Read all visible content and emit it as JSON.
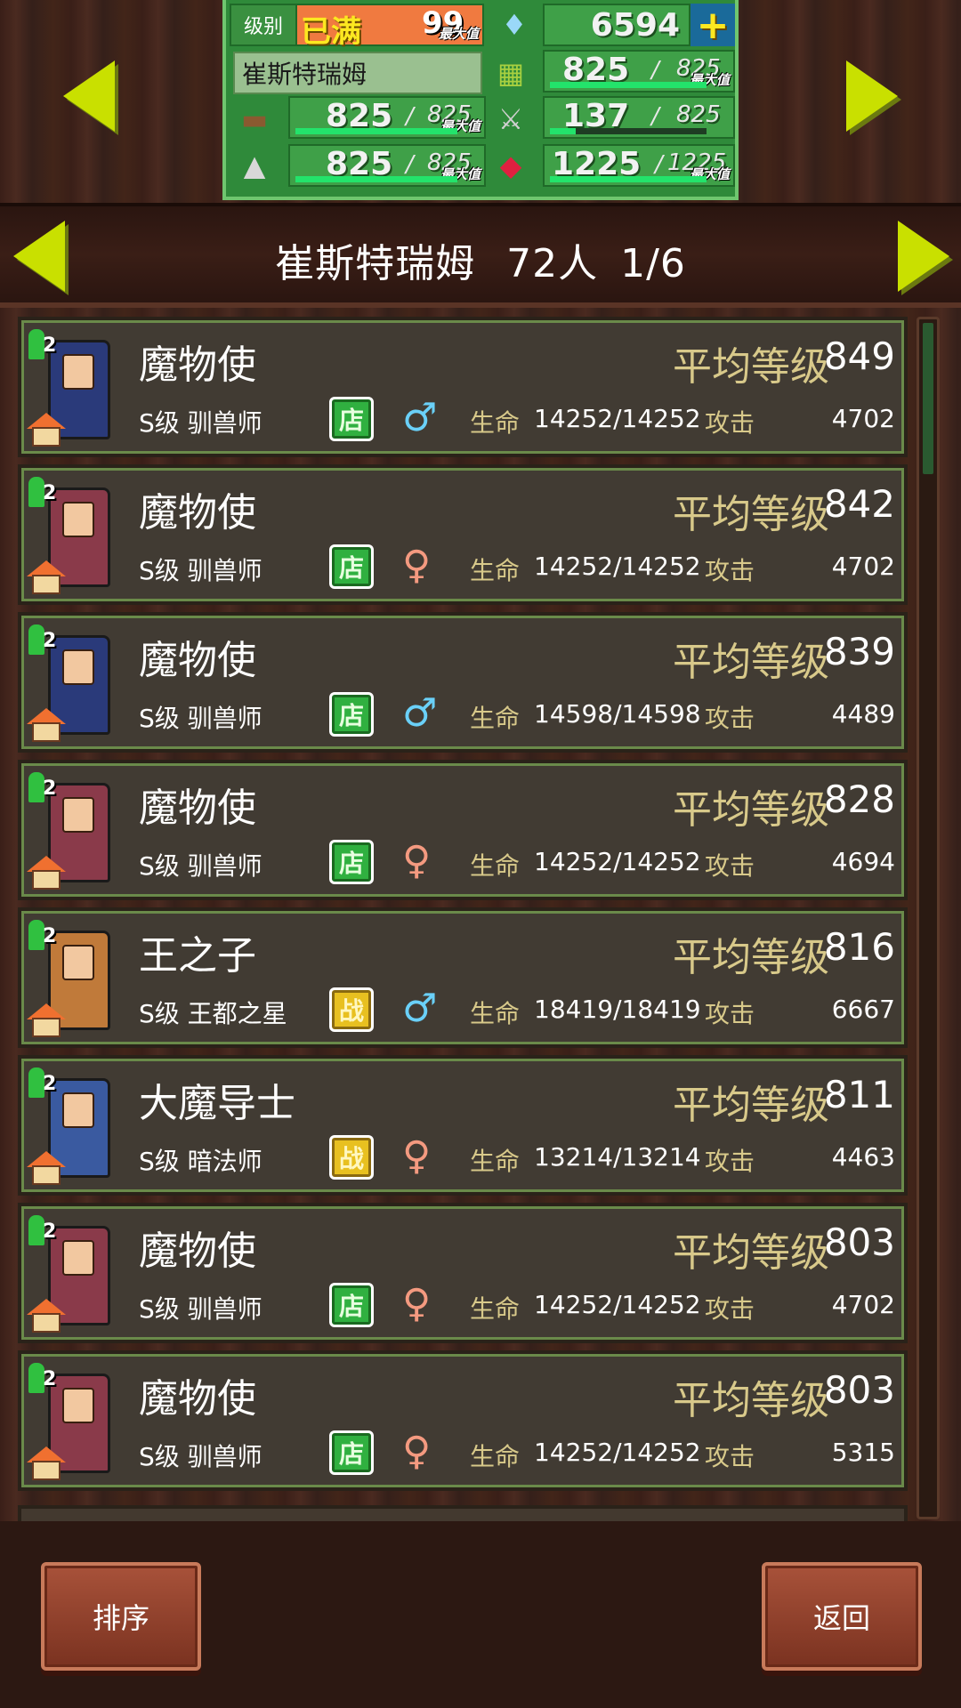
{
  "resources": {
    "level_label": "级别",
    "level_status": "已满",
    "level_value": "99",
    "level_tag": "最大值",
    "gems": "6594",
    "town_name": "崔斯特瑞姆",
    "food": {
      "value": "825",
      "max": "825",
      "tag": "最大值",
      "fill": 1.0
    },
    "wood": {
      "value": "825",
      "max": "825",
      "tag": "最大值",
      "fill": 1.0
    },
    "equipment": {
      "value": "137",
      "max": "825",
      "fill": 0.166
    },
    "ore": {
      "value": "825",
      "max": "825",
      "tag": "最大值",
      "fill": 1.0
    },
    "crystal": {
      "value": "1225",
      "max": "1225",
      "tag": "最大值",
      "fill": 1.0
    }
  },
  "header": {
    "town": "崔斯特瑞姆",
    "count": "72人",
    "page": "1/6"
  },
  "labels": {
    "avg_level": "平均等级",
    "hp": "生命",
    "attack": "攻击"
  },
  "members": [
    {
      "name": "魔物使",
      "avg_level": "849",
      "class": "S级 驯兽师",
      "tag": "店",
      "tag_type": "shop",
      "gender": "male",
      "hp": "14252/14252",
      "attack": "4702",
      "badge": "2",
      "color": "#2a3a7a"
    },
    {
      "name": "魔物使",
      "avg_level": "842",
      "class": "S级 驯兽师",
      "tag": "店",
      "tag_type": "shop",
      "gender": "female",
      "hp": "14252/14252",
      "attack": "4702",
      "badge": "2",
      "color": "#8a3a4a"
    },
    {
      "name": "魔物使",
      "avg_level": "839",
      "class": "S级 驯兽师",
      "tag": "店",
      "tag_type": "shop",
      "gender": "male",
      "hp": "14598/14598",
      "attack": "4489",
      "badge": "2",
      "color": "#2a3a7a"
    },
    {
      "name": "魔物使",
      "avg_level": "828",
      "class": "S级 驯兽师",
      "tag": "店",
      "tag_type": "shop",
      "gender": "female",
      "hp": "14252/14252",
      "attack": "4694",
      "badge": "2",
      "color": "#8a3a4a"
    },
    {
      "name": "王之子",
      "avg_level": "816",
      "class": "S级 王都之星",
      "tag": "战",
      "tag_type": "battle",
      "gender": "male",
      "hp": "18419/18419",
      "attack": "6667",
      "badge": "2",
      "color": "#c07a3a"
    },
    {
      "name": "大魔导士",
      "avg_level": "811",
      "class": "S级 暗法师",
      "tag": "战",
      "tag_type": "battle",
      "gender": "female",
      "hp": "13214/13214",
      "attack": "4463",
      "badge": "2",
      "color": "#3a5aa0"
    },
    {
      "name": "魔物使",
      "avg_level": "803",
      "class": "S级 驯兽师",
      "tag": "店",
      "tag_type": "shop",
      "gender": "female",
      "hp": "14252/14252",
      "attack": "4702",
      "badge": "2",
      "color": "#8a3a4a"
    },
    {
      "name": "魔物使",
      "avg_level": "803",
      "class": "S级 驯兽师",
      "tag": "店",
      "tag_type": "shop",
      "gender": "female",
      "hp": "14252/14252",
      "attack": "5315",
      "badge": "2",
      "color": "#8a3a4a"
    }
  ],
  "buttons": {
    "sort": "排序",
    "back": "返回"
  },
  "colors": {
    "accent_yellow": "#c9e000",
    "panel_green": "#2f8a3a",
    "row_bg": "#413b33",
    "label_gold": "#d8c98a"
  }
}
